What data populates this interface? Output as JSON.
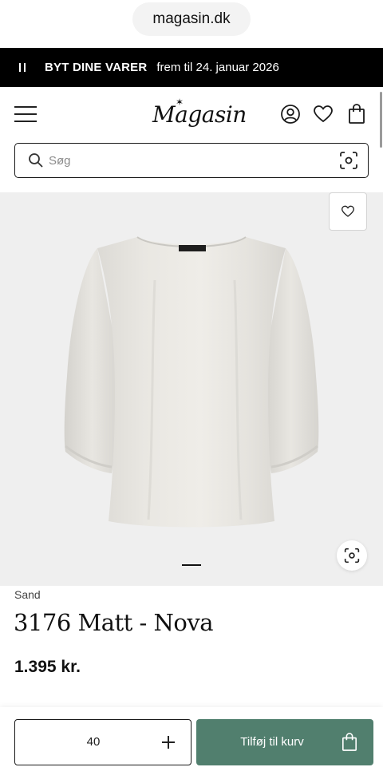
{
  "browser": {
    "url": "magasin.dk"
  },
  "promo": {
    "bold": "BYT DINE VARER",
    "text": "frem til 24. januar 2026"
  },
  "header": {
    "logo": "Magasin"
  },
  "search": {
    "placeholder": "Søg"
  },
  "gallery": {
    "current_slide": 1
  },
  "product": {
    "brand": "Sand",
    "name": "3176 Matt - Nova",
    "price": "1.395 kr."
  },
  "cart": {
    "size": "40",
    "add_label": "Tilføj til kurv"
  },
  "colors": {
    "accent": "#517f6e",
    "banner": "#000000",
    "image_bg": "#efefef"
  }
}
